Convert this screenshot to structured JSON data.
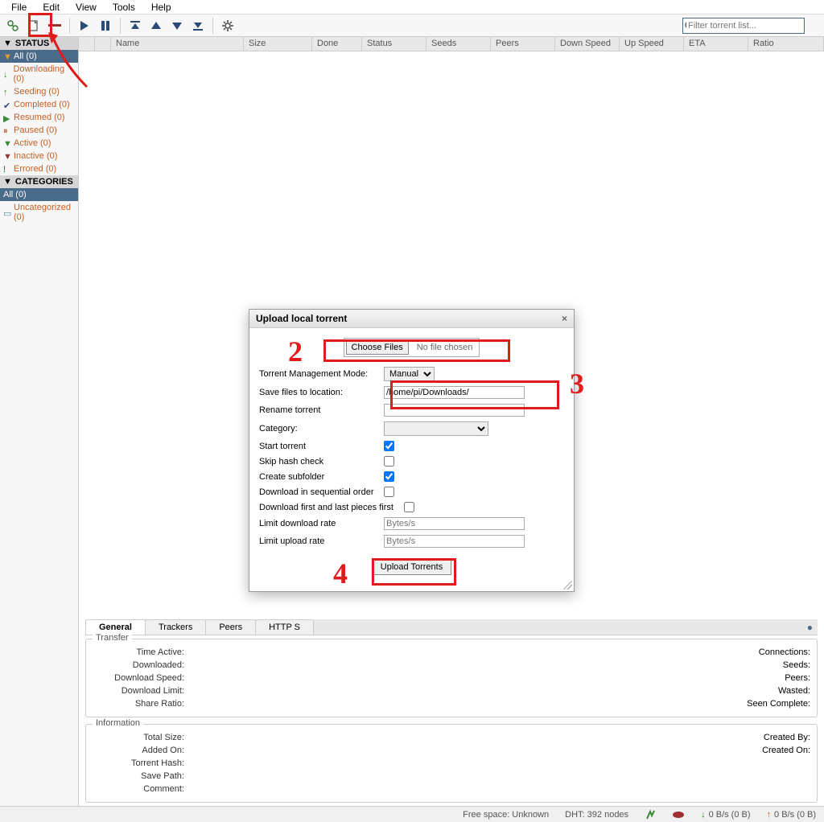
{
  "menu": {
    "file": "File",
    "edit": "Edit",
    "view": "View",
    "tools": "Tools",
    "help": "Help"
  },
  "toolbar": {
    "search_placeholder": "Filter torrent list..."
  },
  "sidebar": {
    "status_header": "STATUS",
    "categories_header": "CATEGORIES",
    "status": [
      {
        "label": "All (0)"
      },
      {
        "label": "Downloading (0)"
      },
      {
        "label": "Seeding (0)"
      },
      {
        "label": "Completed (0)"
      },
      {
        "label": "Resumed (0)"
      },
      {
        "label": "Paused (0)"
      },
      {
        "label": "Active (0)"
      },
      {
        "label": "Inactive (0)"
      },
      {
        "label": "Errored (0)"
      }
    ],
    "categories": [
      {
        "label": "All (0)"
      },
      {
        "label": "Uncategorized (0)"
      }
    ]
  },
  "columns": {
    "name": "Name",
    "size": "Size",
    "done": "Done",
    "status": "Status",
    "seeds": "Seeds",
    "peers": "Peers",
    "down": "Down Speed",
    "up": "Up Speed",
    "eta": "ETA",
    "ratio": "Ratio"
  },
  "tabs": {
    "general": "General",
    "trackers": "Trackers",
    "peers": "Peers",
    "http": "HTTP S"
  },
  "transfer": {
    "title": "Transfer",
    "time_active": "Time Active:",
    "downloaded": "Downloaded:",
    "download_speed": "Download Speed:",
    "download_limit": "Download Limit:",
    "share_ratio": "Share Ratio:",
    "connections": "Connections:",
    "seeds": "Seeds:",
    "peers": "Peers:",
    "wasted": "Wasted:",
    "seen_complete": "Seen Complete:"
  },
  "information": {
    "title": "Information",
    "total_size": "Total Size:",
    "added_on": "Added On:",
    "torrent_hash": "Torrent Hash:",
    "save_path": "Save Path:",
    "comment": "Comment:",
    "created_by": "Created By:",
    "created_on": "Created On:"
  },
  "statusbar": {
    "free_space": "Free space: Unknown",
    "dht": "DHT: 392 nodes",
    "down": "0 B/s (0 B)",
    "up": "0 B/s (0 B)"
  },
  "dialog": {
    "title": "Upload local torrent",
    "choose_files": "Choose Files",
    "no_file": "No file chosen",
    "mgmt_mode": "Torrent Management Mode:",
    "mgmt_value": "Manual",
    "save_loc": "Save files to location:",
    "save_loc_value": "/home/pi/Downloads/",
    "rename": "Rename torrent",
    "category": "Category:",
    "start": "Start torrent",
    "skip_hash": "Skip hash check",
    "create_sub": "Create subfolder",
    "sequential": "Download in sequential order",
    "first_last": "Download first and last pieces first",
    "limit_down": "Limit download rate",
    "limit_up": "Limit upload rate",
    "bytes_placeholder": "Bytes/s",
    "upload_btn": "Upload Torrents"
  },
  "annotations": {
    "n2": "2",
    "n3": "3",
    "n4": "4"
  }
}
